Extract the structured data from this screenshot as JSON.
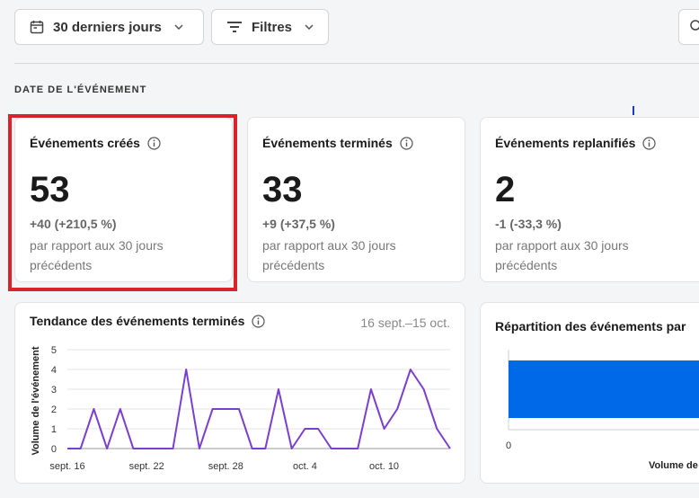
{
  "toolbar": {
    "date_range_label": "30 derniers jours",
    "filters_label": "Filtres"
  },
  "section_label": "DATE DE L'ÉVÉNEMENT",
  "kpis": [
    {
      "title": "Événements créés",
      "value": "53",
      "delta": "+40 (+210,5 %)",
      "sub": "par rapport aux 30 jours précédents"
    },
    {
      "title": "Événements terminés",
      "value": "33",
      "delta": "+9 (+37,5 %)",
      "sub": "par rapport aux 30 jours précédents"
    },
    {
      "title": "Événements replanifiés",
      "value": "2",
      "delta": "-1 (-33,3 %)",
      "sub": "par rapport aux 30 jours précédents"
    }
  ],
  "trend_card": {
    "title": "Tendance des événements terminés",
    "range": "16 sept.–15 oct."
  },
  "distribution_card": {
    "title": "Répartition des événements par",
    "x_tick": "0",
    "x_label": "Volume de"
  },
  "colors": {
    "line": "#7b3fd0",
    "bar": "#0069e8",
    "highlight": "#d9232a"
  },
  "chart_data": [
    {
      "type": "line",
      "title": "Tendance des événements terminés",
      "ylabel": "Volume de l'événement",
      "ylim": [
        0,
        5
      ],
      "yticks": [
        0,
        1,
        2,
        3,
        4,
        5
      ],
      "x_tick_labels": [
        "sept. 16",
        "sept. 22",
        "sept. 28",
        "oct. 4",
        "oct. 10"
      ],
      "x_tick_index": [
        0,
        6,
        12,
        18,
        24
      ],
      "values": [
        0,
        0,
        2,
        0,
        2,
        0,
        0,
        0,
        0,
        4,
        0,
        2,
        2,
        2,
        0,
        0,
        3,
        0,
        1,
        1,
        0,
        0,
        0,
        3,
        1,
        2,
        4,
        3,
        1,
        0
      ],
      "grid": true
    },
    {
      "type": "bar",
      "title": "Répartition des événements par",
      "xlabel": "Volume de",
      "xticks": [
        0
      ],
      "orientation": "horizontal"
    }
  ]
}
